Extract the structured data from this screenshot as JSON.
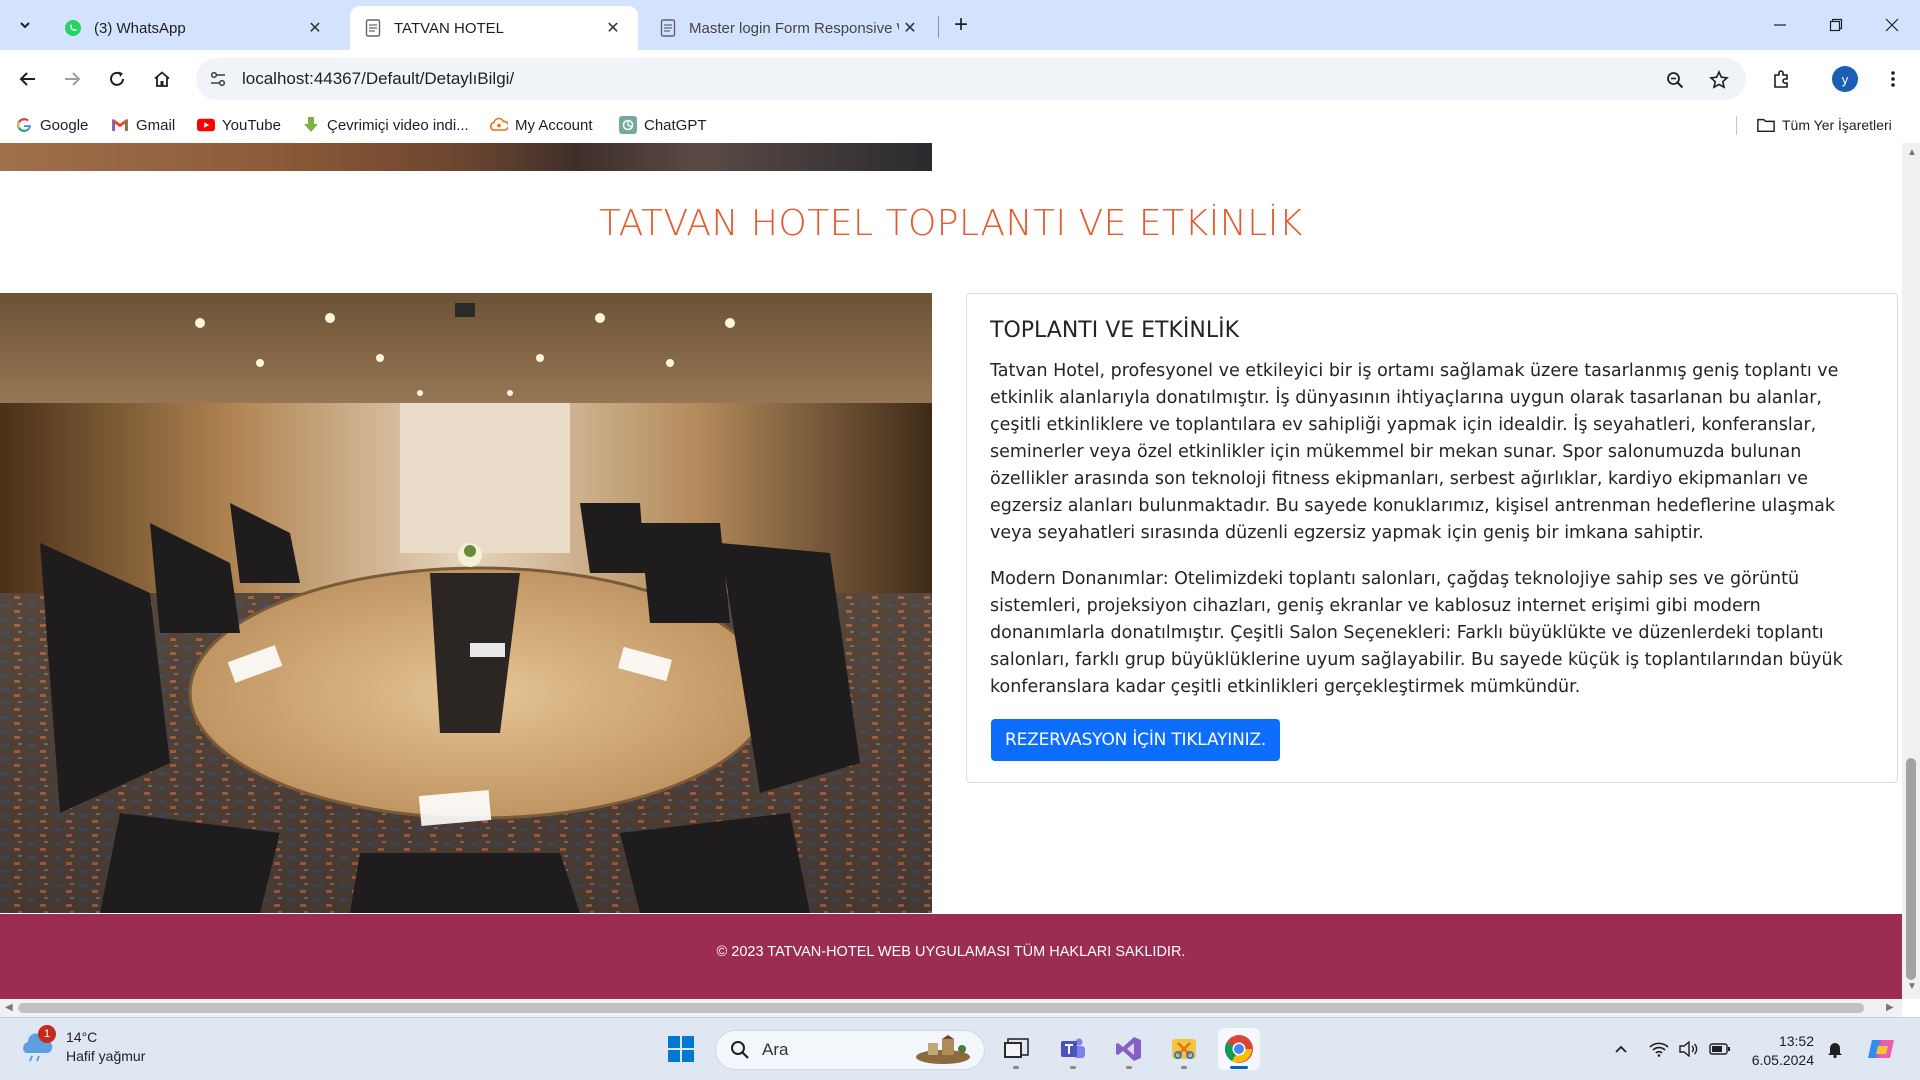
{
  "browser": {
    "tabs": [
      {
        "title": "(3) WhatsApp",
        "icon": "whatsapp-icon",
        "active": false
      },
      {
        "title": "TATVAN HOTEL",
        "icon": "page-icon",
        "active": true
      },
      {
        "title": "Master login Form Responsive W",
        "icon": "page-icon",
        "active": false
      }
    ],
    "url": "localhost:44367/Default/DetaylıBilgi/",
    "profile_initial": "y",
    "bookmarks": [
      {
        "label": "Google",
        "icon": "google-icon"
      },
      {
        "label": "Gmail",
        "icon": "gmail-icon"
      },
      {
        "label": "YouTube",
        "icon": "youtube-icon"
      },
      {
        "label": "Çevrimiçi video indi...",
        "icon": "download-icon"
      },
      {
        "label": "My Account",
        "icon": "account-icon"
      },
      {
        "label": "ChatGPT",
        "icon": "chatgpt-icon"
      }
    ],
    "all_bookmarks_label": "Tüm Yer İşaretleri"
  },
  "page": {
    "heading": "TATVAN HOTEL TOPLANTI VE ETKİNLİK",
    "card": {
      "title": "TOPLANTI VE ETKİNLİK",
      "paragraph1": "Tatvan Hotel, profesyonel ve etkileyici bir iş ortamı sağlamak üzere tasarlanmış geniş toplantı ve etkinlik alanlarıyla donatılmıştır. İş dünyasının ihtiyaçlarına uygun olarak tasarlanan bu alanlar, çeşitli etkinliklere ve toplantılara ev sahipliği yapmak için idealdir. İş seyahatleri, konferanslar, seminerler veya özel etkinlikler için mükemmel bir mekan sunar. Spor salonumuzda bulunan özellikler arasında son teknoloji fitness ekipmanları, serbest ağırlıklar, kardiyo ekipmanları ve egzersiz alanları bulunmaktadır. Bu sayede konuklarımız, kişisel antrenman hedeflerine ulaşmak veya seyahatleri sırasında düzenli egzersiz yapmak için geniş bir imkana sahiptir.",
      "paragraph2": "Modern Donanımlar: Otelimizdeki toplantı salonları, çağdaş teknolojiye sahip ses ve görüntü sistemleri, projeksiyon cihazları, geniş ekranlar ve kablosuz internet erişimi gibi modern donanımlarla donatılmıştır. Çeşitli Salon Seçenekleri: Farklı büyüklükte ve düzenlerdeki toplantı salonları, farklı grup büyüklüklerine uyum sağlayabilir. Bu sayede küçük iş toplantılarından büyük konferanslara kadar çeşitli etkinlikleri gerçekleştirmek mümkündür.",
      "button_label": "REZERVASYON İÇİN TIKLAYINIZ."
    },
    "footer_text": "© 2023 TATVAN-HOTEL WEB UYGULAMASI TÜM HAKLARI SAKLIDIR."
  },
  "taskbar": {
    "weather": {
      "temp": "14°C",
      "condition": "Hafif yağmur",
      "badge": "1"
    },
    "search_placeholder": "Ara",
    "apps": [
      "start-icon",
      "file-explorer-icon",
      "teams-icon",
      "visual-studio-icon",
      "snipping-tool-icon",
      "chrome-icon"
    ],
    "time": "13:52",
    "date": "6.05.2024"
  },
  "colors": {
    "heading": "#e5592a",
    "button": "#0d6efd",
    "footer": "#9b2d52",
    "tabbar": "#d3e3fd"
  }
}
